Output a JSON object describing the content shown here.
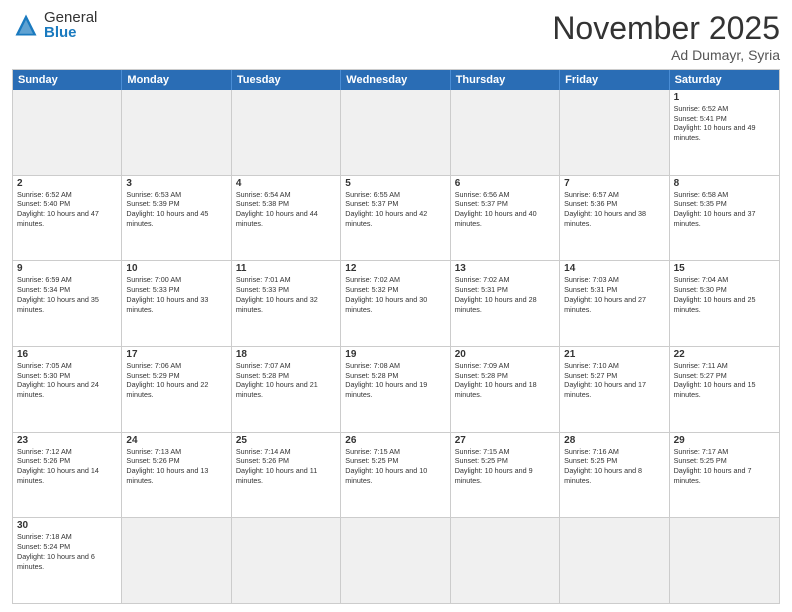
{
  "header": {
    "logo_general": "General",
    "logo_blue": "Blue",
    "month_title": "November 2025",
    "location": "Ad Dumayr, Syria"
  },
  "weekdays": [
    "Sunday",
    "Monday",
    "Tuesday",
    "Wednesday",
    "Thursday",
    "Friday",
    "Saturday"
  ],
  "weeks": [
    [
      {
        "day": "",
        "empty": true
      },
      {
        "day": "",
        "empty": true
      },
      {
        "day": "",
        "empty": true
      },
      {
        "day": "",
        "empty": true
      },
      {
        "day": "",
        "empty": true
      },
      {
        "day": "",
        "empty": true
      },
      {
        "day": "1",
        "sunrise": "Sunrise: 6:52 AM",
        "sunset": "Sunset: 5:41 PM",
        "daylight": "Daylight: 10 hours and 49 minutes."
      }
    ],
    [
      {
        "day": "2",
        "sunrise": "Sunrise: 6:52 AM",
        "sunset": "Sunset: 5:40 PM",
        "daylight": "Daylight: 10 hours and 47 minutes."
      },
      {
        "day": "3",
        "sunrise": "Sunrise: 6:53 AM",
        "sunset": "Sunset: 5:39 PM",
        "daylight": "Daylight: 10 hours and 45 minutes."
      },
      {
        "day": "4",
        "sunrise": "Sunrise: 6:54 AM",
        "sunset": "Sunset: 5:38 PM",
        "daylight": "Daylight: 10 hours and 44 minutes."
      },
      {
        "day": "5",
        "sunrise": "Sunrise: 6:55 AM",
        "sunset": "Sunset: 5:37 PM",
        "daylight": "Daylight: 10 hours and 42 minutes."
      },
      {
        "day": "6",
        "sunrise": "Sunrise: 6:56 AM",
        "sunset": "Sunset: 5:37 PM",
        "daylight": "Daylight: 10 hours and 40 minutes."
      },
      {
        "day": "7",
        "sunrise": "Sunrise: 6:57 AM",
        "sunset": "Sunset: 5:36 PM",
        "daylight": "Daylight: 10 hours and 38 minutes."
      },
      {
        "day": "8",
        "sunrise": "Sunrise: 6:58 AM",
        "sunset": "Sunset: 5:35 PM",
        "daylight": "Daylight: 10 hours and 37 minutes."
      }
    ],
    [
      {
        "day": "9",
        "sunrise": "Sunrise: 6:59 AM",
        "sunset": "Sunset: 5:34 PM",
        "daylight": "Daylight: 10 hours and 35 minutes."
      },
      {
        "day": "10",
        "sunrise": "Sunrise: 7:00 AM",
        "sunset": "Sunset: 5:33 PM",
        "daylight": "Daylight: 10 hours and 33 minutes."
      },
      {
        "day": "11",
        "sunrise": "Sunrise: 7:01 AM",
        "sunset": "Sunset: 5:33 PM",
        "daylight": "Daylight: 10 hours and 32 minutes."
      },
      {
        "day": "12",
        "sunrise": "Sunrise: 7:02 AM",
        "sunset": "Sunset: 5:32 PM",
        "daylight": "Daylight: 10 hours and 30 minutes."
      },
      {
        "day": "13",
        "sunrise": "Sunrise: 7:02 AM",
        "sunset": "Sunset: 5:31 PM",
        "daylight": "Daylight: 10 hours and 28 minutes."
      },
      {
        "day": "14",
        "sunrise": "Sunrise: 7:03 AM",
        "sunset": "Sunset: 5:31 PM",
        "daylight": "Daylight: 10 hours and 27 minutes."
      },
      {
        "day": "15",
        "sunrise": "Sunrise: 7:04 AM",
        "sunset": "Sunset: 5:30 PM",
        "daylight": "Daylight: 10 hours and 25 minutes."
      }
    ],
    [
      {
        "day": "16",
        "sunrise": "Sunrise: 7:05 AM",
        "sunset": "Sunset: 5:30 PM",
        "daylight": "Daylight: 10 hours and 24 minutes."
      },
      {
        "day": "17",
        "sunrise": "Sunrise: 7:06 AM",
        "sunset": "Sunset: 5:29 PM",
        "daylight": "Daylight: 10 hours and 22 minutes."
      },
      {
        "day": "18",
        "sunrise": "Sunrise: 7:07 AM",
        "sunset": "Sunset: 5:28 PM",
        "daylight": "Daylight: 10 hours and 21 minutes."
      },
      {
        "day": "19",
        "sunrise": "Sunrise: 7:08 AM",
        "sunset": "Sunset: 5:28 PM",
        "daylight": "Daylight: 10 hours and 19 minutes."
      },
      {
        "day": "20",
        "sunrise": "Sunrise: 7:09 AM",
        "sunset": "Sunset: 5:28 PM",
        "daylight": "Daylight: 10 hours and 18 minutes."
      },
      {
        "day": "21",
        "sunrise": "Sunrise: 7:10 AM",
        "sunset": "Sunset: 5:27 PM",
        "daylight": "Daylight: 10 hours and 17 minutes."
      },
      {
        "day": "22",
        "sunrise": "Sunrise: 7:11 AM",
        "sunset": "Sunset: 5:27 PM",
        "daylight": "Daylight: 10 hours and 15 minutes."
      }
    ],
    [
      {
        "day": "23",
        "sunrise": "Sunrise: 7:12 AM",
        "sunset": "Sunset: 5:26 PM",
        "daylight": "Daylight: 10 hours and 14 minutes."
      },
      {
        "day": "24",
        "sunrise": "Sunrise: 7:13 AM",
        "sunset": "Sunset: 5:26 PM",
        "daylight": "Daylight: 10 hours and 13 minutes."
      },
      {
        "day": "25",
        "sunrise": "Sunrise: 7:14 AM",
        "sunset": "Sunset: 5:26 PM",
        "daylight": "Daylight: 10 hours and 11 minutes."
      },
      {
        "day": "26",
        "sunrise": "Sunrise: 7:15 AM",
        "sunset": "Sunset: 5:25 PM",
        "daylight": "Daylight: 10 hours and 10 minutes."
      },
      {
        "day": "27",
        "sunrise": "Sunrise: 7:15 AM",
        "sunset": "Sunset: 5:25 PM",
        "daylight": "Daylight: 10 hours and 9 minutes."
      },
      {
        "day": "28",
        "sunrise": "Sunrise: 7:16 AM",
        "sunset": "Sunset: 5:25 PM",
        "daylight": "Daylight: 10 hours and 8 minutes."
      },
      {
        "day": "29",
        "sunrise": "Sunrise: 7:17 AM",
        "sunset": "Sunset: 5:25 PM",
        "daylight": "Daylight: 10 hours and 7 minutes."
      }
    ],
    [
      {
        "day": "30",
        "sunrise": "Sunrise: 7:18 AM",
        "sunset": "Sunset: 5:24 PM",
        "daylight": "Daylight: 10 hours and 6 minutes."
      },
      {
        "day": "",
        "empty": true
      },
      {
        "day": "",
        "empty": true
      },
      {
        "day": "",
        "empty": true
      },
      {
        "day": "",
        "empty": true
      },
      {
        "day": "",
        "empty": true
      },
      {
        "day": "",
        "empty": true
      }
    ]
  ]
}
